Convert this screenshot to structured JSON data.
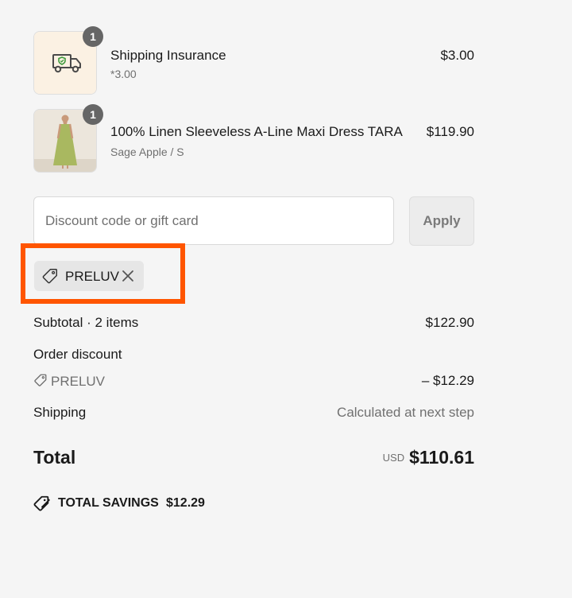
{
  "line_items": [
    {
      "quantity": "1",
      "name": "Shipping Insurance",
      "subtitle": "*3.00",
      "price": "$3.00",
      "image_icon": "delivery-truck-icon"
    },
    {
      "quantity": "1",
      "name": "100% Linen Sleeveless A-Line Maxi Dress TARA",
      "subtitle": "Sage Apple / S",
      "price": "$119.90",
      "image_icon": "dress-photo"
    }
  ],
  "discount": {
    "placeholder": "Discount code or gift card",
    "apply_label": "Apply",
    "applied_code": "PRELUV",
    "highlight_color": "#ff5500"
  },
  "summary": {
    "subtotal_label": "Subtotal · 2 items",
    "subtotal_value": "$122.90",
    "order_discount_label": "Order discount",
    "discount_code": "PRELUV",
    "discount_value": "– $12.29",
    "shipping_label": "Shipping",
    "shipping_value": "Calculated at next step",
    "total_label": "Total",
    "currency": "USD",
    "total_value": "$110.61"
  },
  "savings": {
    "label": "TOTAL SAVINGS",
    "amount": "$12.29"
  }
}
